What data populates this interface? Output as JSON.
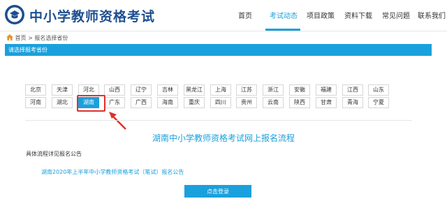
{
  "header": {
    "site_title": "中小学教师资格考试",
    "logo_icon": "education-emblem-icon",
    "nav": [
      {
        "label": "首页",
        "active": false
      },
      {
        "label": "考试动态",
        "active": true
      },
      {
        "label": "项目政策",
        "active": false
      },
      {
        "label": "资料下载",
        "active": false
      },
      {
        "label": "常见问题",
        "active": false
      },
      {
        "label": "联系我们",
        "active": false
      }
    ]
  },
  "breadcrumb": {
    "icon": "home-icon",
    "text": "首页 > 报名选择省份"
  },
  "section": {
    "heading": "请选择报考省份"
  },
  "provinces": {
    "row1": [
      "北京",
      "天津",
      "河北",
      "山西",
      "辽宁",
      "吉林",
      "黑龙江",
      "上海",
      "江苏",
      "浙江",
      "安徽",
      "福建",
      "江西",
      "山东"
    ],
    "row2": [
      "河南",
      "湖北",
      "湖南",
      "广东",
      "广西",
      "海南",
      "重庆",
      "四川",
      "贵州",
      "云南",
      "陕西",
      "甘肃",
      "青海",
      "宁夏"
    ],
    "selected": "湖南"
  },
  "content": {
    "flow_title": "湖南中小学教师资格考试网上报名流程",
    "notice_label": "具体流程详见报名公告",
    "notice_link": "湖南2020年上半年中小学教师资格考试（笔试）报名公告",
    "login_button": "点击登录"
  },
  "colors": {
    "accent": "#1aa0dc",
    "brand": "#1d4f8f",
    "annotation": "#e0312b"
  }
}
